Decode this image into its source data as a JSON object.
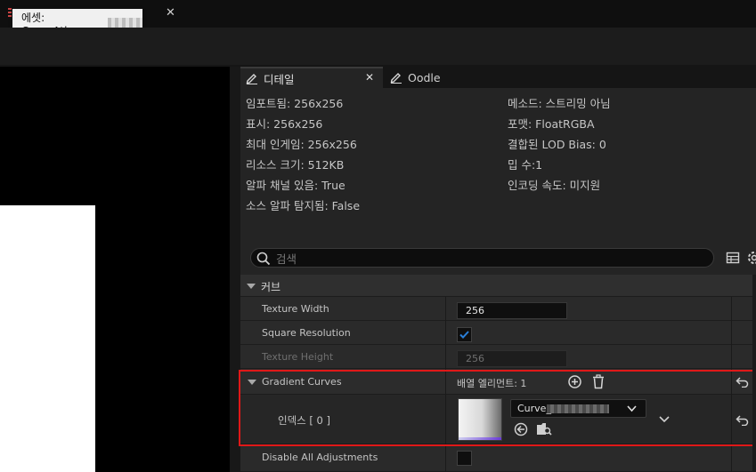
{
  "asset_tab": {
    "label": "에셋: CurveAtlas_"
  },
  "details_tab": {
    "label": "디테일"
  },
  "oodle_tab": {
    "label": "Oodle"
  },
  "info_left": [
    "임포트됨: 256x256",
    "표시: 256x256",
    "최대 인게임: 256x256",
    "리소스 크기: 512KB",
    "알파 채널 있음: True",
    "소스 알파 탐지됨: False"
  ],
  "info_right": [
    "메소드: 스트리밍 아님",
    "포맷: FloatRGBA",
    "결합된 LOD Bias: 0",
    "밉 수:1",
    "인코딩 속도: 미지원"
  ],
  "search": {
    "placeholder": "검색"
  },
  "category": {
    "label": "커브"
  },
  "properties": {
    "texture_width": {
      "label": "Texture Width",
      "value": "256"
    },
    "square_resolution": {
      "label": "Square Resolution",
      "checked": true
    },
    "texture_height": {
      "label": "Texture Height",
      "value": "256"
    },
    "gradient_curves": {
      "label": "Gradient Curves",
      "array_label": "배열 엘리먼트: 1"
    },
    "index": {
      "label": "인덱스 [ 0 ]",
      "curve_value": "Curve_"
    },
    "disable_all_adjustments": {
      "label": "Disable All Adjustments",
      "checked": false
    }
  },
  "colors": {
    "highlight_border": "#e01818",
    "check_accent": "#2a7fd8"
  }
}
